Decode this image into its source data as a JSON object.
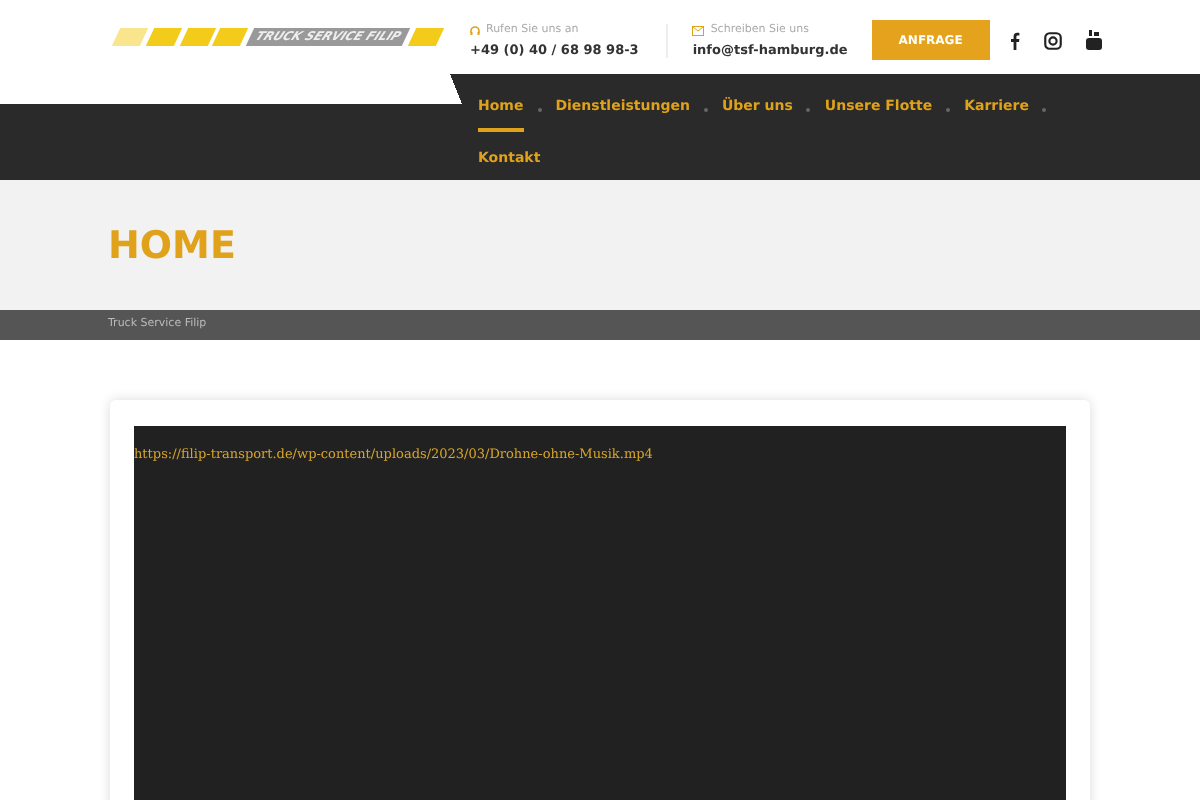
{
  "header": {
    "logo_text": "TRUCK SERVICE FILIP",
    "phone": {
      "label": "Rufen Sie uns an",
      "value": "+49 (0) 40 / 68 98 98-3"
    },
    "email": {
      "label": "Schreiben Sie uns",
      "value": "info@tsf-hamburg.de"
    },
    "button": "ANFRAGE"
  },
  "nav": [
    {
      "label": "Home",
      "selected": true
    },
    {
      "label": "Dienstleistungen",
      "selected": false
    },
    {
      "label": "Über uns",
      "selected": false
    },
    {
      "label": "Unsere Flotte",
      "selected": false
    },
    {
      "label": "Karriere",
      "selected": false
    },
    {
      "label": "Kontakt",
      "selected": false
    }
  ],
  "page_title": "HOME",
  "breadcrumb": "Truck Service Filip",
  "video": {
    "link": "https://filip-transport.de/wp-content/uploads/2023/03/Drohne-ohne-Musik.mp4"
  }
}
